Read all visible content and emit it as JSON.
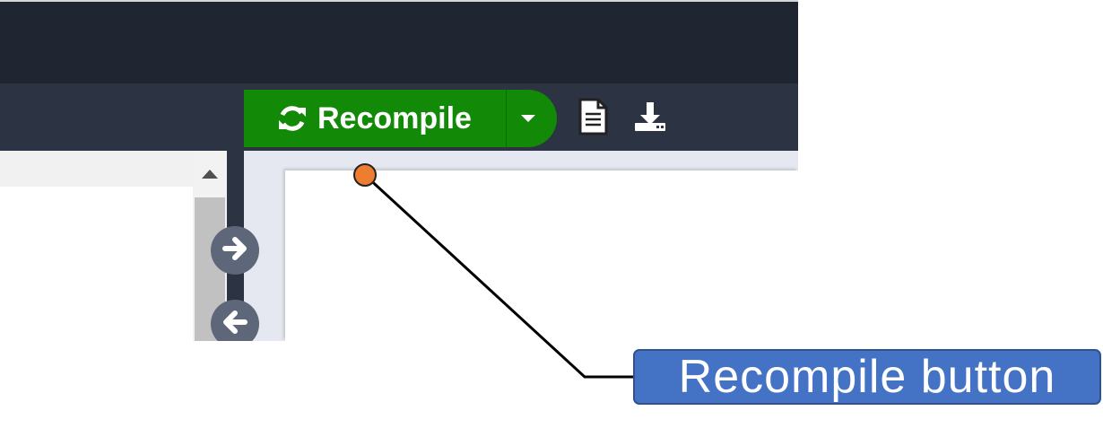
{
  "toolbar": {
    "recompile_label": "Recompile",
    "recompile_icon": "refresh-icon",
    "dropdown_icon": "caret-down-icon",
    "logs_icon": "document-icon",
    "download_icon": "download-icon"
  },
  "editor": {
    "scroll_up_icon": "triangle-up-icon",
    "panel_toggle_icons": [
      "arrow-right-icon",
      "arrow-left-icon"
    ]
  },
  "annotation": {
    "label": "Recompile button"
  },
  "colors": {
    "recompile_green": "#138a07",
    "topbar": "#202532",
    "toolbar": "#2c3342",
    "callout_blue": "#4472c4",
    "pointer_orange": "#ed7d31"
  }
}
